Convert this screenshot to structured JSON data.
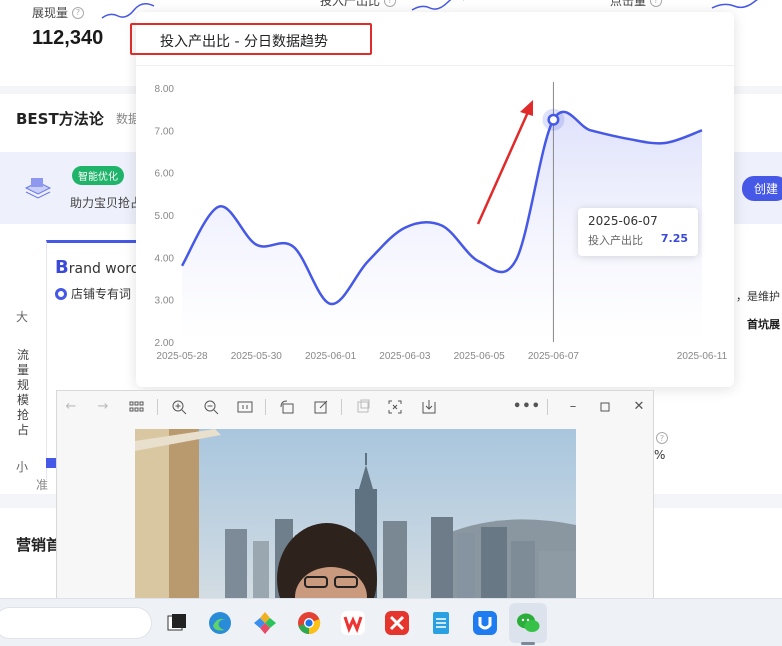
{
  "top_metrics": [
    {
      "label": "展现量",
      "value": "112,340"
    },
    {
      "label": "投入产出比",
      "value": ""
    },
    {
      "label": "点击量",
      "value": ""
    }
  ],
  "best": {
    "title": "BEST方法论",
    "subtitle": "数据",
    "smart_badge": "智能优化",
    "smart_text": "助力宝贝抢占",
    "create_button": "创建"
  },
  "brand_card": {
    "title_initial": "B",
    "title_rest": "rand word",
    "radio_label": "店铺专有词"
  },
  "vertical_axis": {
    "top": "大",
    "word": "流量规模抢占",
    "bottom": "小"
  },
  "zhun": "准",
  "right_notes": {
    "line1": "，是维护",
    "line2": "首坑展",
    "pct": "%"
  },
  "marketing_title": "营销首",
  "popup": {
    "title": "投入产出比 - 分日数据趋势",
    "tooltip": {
      "date": "2025-06-07",
      "label": "投入产出比",
      "value": "7.25"
    }
  },
  "chart_data": {
    "type": "area",
    "title": "投入产出比 - 分日数据趋势",
    "x": [
      "2025-05-28",
      "2025-05-29",
      "2025-05-30",
      "2025-05-31",
      "2025-06-01",
      "2025-06-02",
      "2025-06-03",
      "2025-06-04",
      "2025-06-05",
      "2025-06-06",
      "2025-06-07",
      "2025-06-08",
      "2025-06-09",
      "2025-06-10",
      "2025-06-11"
    ],
    "x_tick_labels": [
      "2025-05-28",
      "2025-05-30",
      "2025-06-01",
      "2025-06-03",
      "2025-06-05",
      "2025-06-07",
      "2025-06-11"
    ],
    "series": [
      {
        "values": [
          3.8,
          5.2,
          4.3,
          4.25,
          2.9,
          3.9,
          4.7,
          4.75,
          3.9,
          3.95,
          7.25,
          7.0,
          6.8,
          6.7,
          7.0
        ]
      }
    ],
    "y_ticks": [
      "8.00",
      "7.00",
      "6.00",
      "5.00",
      "4.00",
      "3.00",
      "2.00"
    ],
    "ylim": [
      2,
      8
    ],
    "highlight_index": 10,
    "line_color": "#4658e6",
    "fill_color": "#dfe2fb",
    "grid": false
  },
  "viewer": {
    "toolbar_icons": [
      "back-arrow-icon",
      "forward-arrow-icon",
      "grid-view-icon",
      "zoom-in-icon",
      "zoom-out-icon",
      "actual-size-icon",
      "rotate-icon",
      "edit-icon",
      "crop-icon",
      "fullscreen-icon",
      "save-icon",
      "more-icon",
      "minimize-icon",
      "maximize-icon",
      "close-icon"
    ]
  },
  "taskbar": {
    "apps": [
      "task-view",
      "edge",
      "colorful-app",
      "chrome",
      "wps",
      "xmind",
      "notepad",
      "uu",
      "wechat"
    ]
  }
}
